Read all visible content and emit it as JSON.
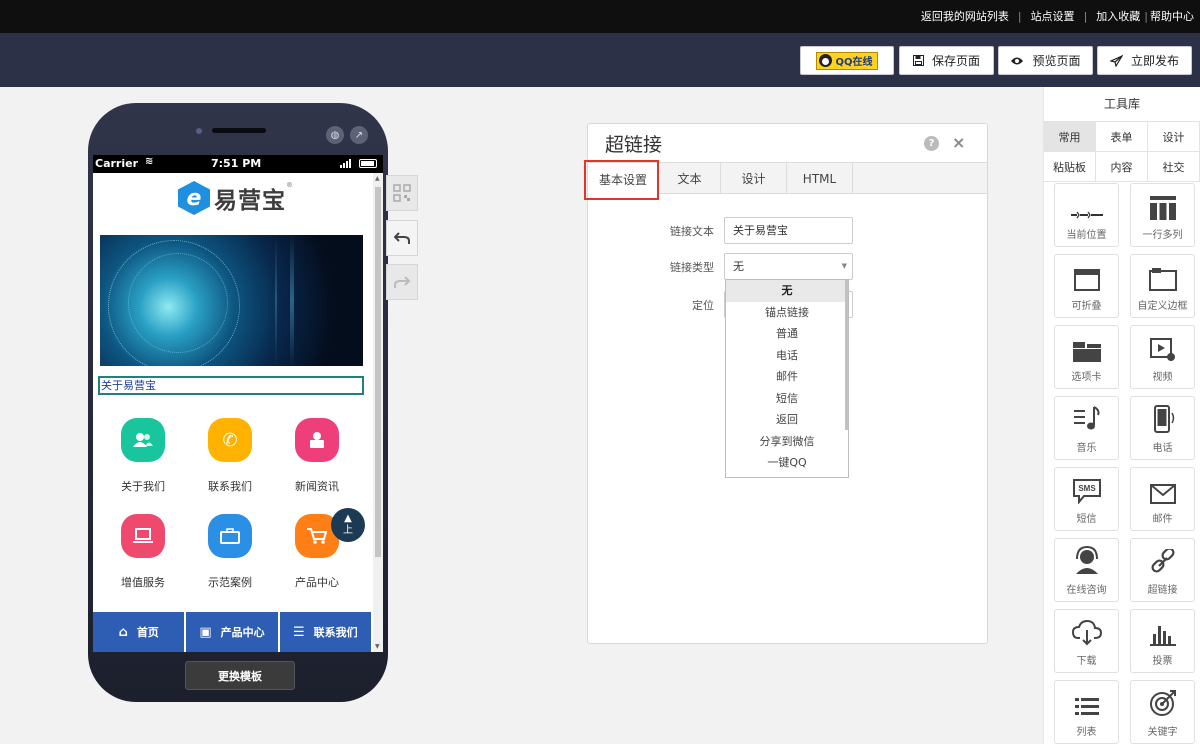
{
  "topbar": {
    "links": [
      "返回我的网站列表",
      "站点设置",
      "加入收藏",
      "帮助中心"
    ]
  },
  "toolbar": {
    "qq_label": "QQ在线",
    "save_label": "保存页面",
    "preview_label": "预览页面",
    "publish_label": "立即发布"
  },
  "phone": {
    "status_carrier": "Carrier",
    "status_time": "7:51 PM",
    "logo_text": "易营宝",
    "logo_mark": "®",
    "about_link": "关于易营宝",
    "grid_items": [
      {
        "label": "关于我们",
        "color": "#19c59d"
      },
      {
        "label": "联系我们",
        "color": "#ffb300"
      },
      {
        "label": "新闻资讯",
        "color": "#ef3f7a"
      },
      {
        "label": "增值服务",
        "color": "#ef4a6e"
      },
      {
        "label": "示范案例",
        "color": "#2c8fe6"
      },
      {
        "label": "产品中心",
        "color": "#ff7f16"
      }
    ],
    "to_top_label": "上",
    "bottom_nav": [
      "首页",
      "产品中心",
      "联系我们"
    ],
    "change_template": "更换模板"
  },
  "dialog": {
    "title": "超链接",
    "help": "?",
    "close": "×",
    "tabs": [
      "基本设置",
      "文本",
      "设计",
      "HTML"
    ],
    "active_tab": "基本设置",
    "fields": {
      "link_text_label": "链接文本",
      "link_text_value": "关于易营宝",
      "link_type_label": "链接类型",
      "link_type_value": "无",
      "position_label": "定位"
    },
    "dropdown_options": [
      "无",
      "锚点链接",
      "普通",
      "电话",
      "邮件",
      "短信",
      "返回",
      "分享到微信",
      "一键QQ"
    ],
    "dropdown_selected": "无"
  },
  "toollib": {
    "title": "工具库",
    "tabs": [
      "常用",
      "表单",
      "设计",
      "粘贴板",
      "内容",
      "社交"
    ],
    "active_tab": "常用",
    "items": [
      {
        "label": "当前位置",
        "icon": "breadcrumb-icon"
      },
      {
        "label": "一行多列",
        "icon": "columns-icon"
      },
      {
        "label": "可折叠",
        "icon": "collapse-icon"
      },
      {
        "label": "自定义边框",
        "icon": "border-icon"
      },
      {
        "label": "选项卡",
        "icon": "tabs-icon"
      },
      {
        "label": "视频",
        "icon": "video-icon"
      },
      {
        "label": "音乐",
        "icon": "music-icon"
      },
      {
        "label": "电话",
        "icon": "phone-icon"
      },
      {
        "label": "短信",
        "icon": "sms-icon"
      },
      {
        "label": "邮件",
        "icon": "mail-icon"
      },
      {
        "label": "在线咨询",
        "icon": "support-icon"
      },
      {
        "label": "超链接",
        "icon": "link-icon"
      },
      {
        "label": "下载",
        "icon": "download-icon"
      },
      {
        "label": "投票",
        "icon": "vote-icon"
      },
      {
        "label": "列表",
        "icon": "list-icon"
      },
      {
        "label": "关键字",
        "icon": "keyword-icon"
      }
    ],
    "sms_icon_text": "SMS"
  }
}
